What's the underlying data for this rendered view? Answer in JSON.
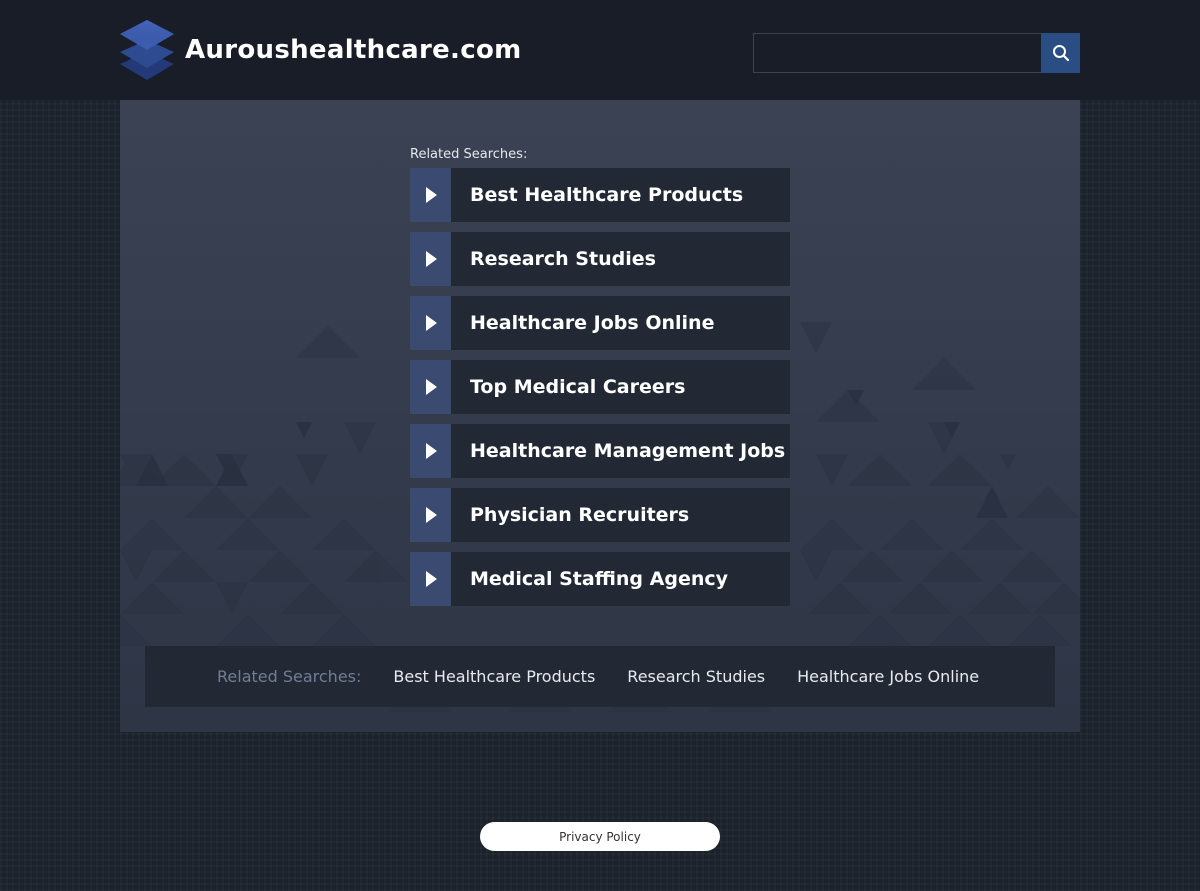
{
  "site": {
    "title": "Auroushealthcare.com",
    "logo_icon": "stacked-layers-icon",
    "accent_color": "#2a4d84"
  },
  "search": {
    "value": "",
    "button_icon": "search-icon"
  },
  "related": {
    "title": "Related Searches:",
    "items": [
      {
        "label": "Best Healthcare Products"
      },
      {
        "label": "Research Studies"
      },
      {
        "label": "Healthcare Jobs Online"
      },
      {
        "label": "Top Medical Careers"
      },
      {
        "label": "Healthcare Management Jobs"
      },
      {
        "label": "Physician Recruiters"
      },
      {
        "label": "Medical Staffing Agency"
      }
    ]
  },
  "bottom_bar": {
    "label": "Related Searches:",
    "links": [
      "Best Healthcare Products",
      "Research Studies",
      "Healthcare Jobs Online"
    ]
  },
  "footer": {
    "privacy_label": "Privacy Policy"
  }
}
